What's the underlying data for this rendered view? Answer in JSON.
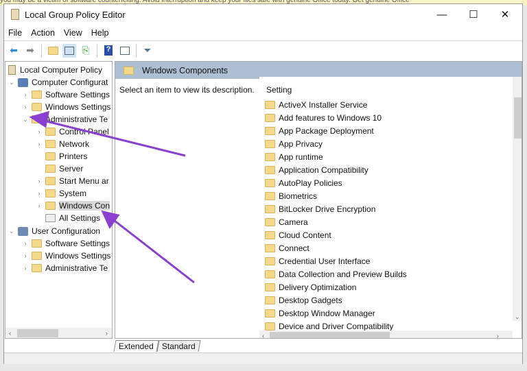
{
  "banner": "you may be a victim of software counterfeiting. Avoid interruption and keep your files safe with genuine Office today.   Get genuine Office",
  "window": {
    "title": "Local Group Policy Editor",
    "minimize": "—",
    "maximize": "☐",
    "close": "✕"
  },
  "menu": [
    "File",
    "Action",
    "View",
    "Help"
  ],
  "toolbar": {
    "icons": [
      "back-arrow-icon",
      "forward-arrow-icon",
      "up-folder-icon",
      "show-hide-tree-icon",
      "export-list-icon",
      "help-icon",
      "properties-icon",
      "filter-icon"
    ]
  },
  "tree": {
    "root": "Local Computer Policy",
    "computer": "Computer Configurat",
    "computer_children": [
      "Software Settings",
      "Windows Settings",
      "Administrative Te"
    ],
    "admin_children": [
      "Control Panel",
      "Network",
      "Printers",
      "Server",
      "Start Menu ar",
      "System",
      "Windows Con",
      "All Settings"
    ],
    "user": "User Configuration",
    "user_children": [
      "Software Settings",
      "Windows Settings",
      "Administrative Te"
    ]
  },
  "right": {
    "header": "Windows Components",
    "description": "Select an item to view its description.",
    "column": "Setting",
    "items": [
      "ActiveX Installer Service",
      "Add features to Windows 10",
      "App Package Deployment",
      "App Privacy",
      "App runtime",
      "Application Compatibility",
      "AutoPlay Policies",
      "Biometrics",
      "BitLocker Drive Encryption",
      "Camera",
      "Cloud Content",
      "Connect",
      "Credential User Interface",
      "Data Collection and Preview Builds",
      "Delivery Optimization",
      "Desktop Gadgets",
      "Desktop Window Manager",
      "Device and Driver Compatibility"
    ]
  },
  "tabs": [
    "Extended",
    "Standard"
  ],
  "colors": {
    "header": "#aebfd4",
    "arrow": "#8a3fd1",
    "folder": "#f5d98a"
  }
}
